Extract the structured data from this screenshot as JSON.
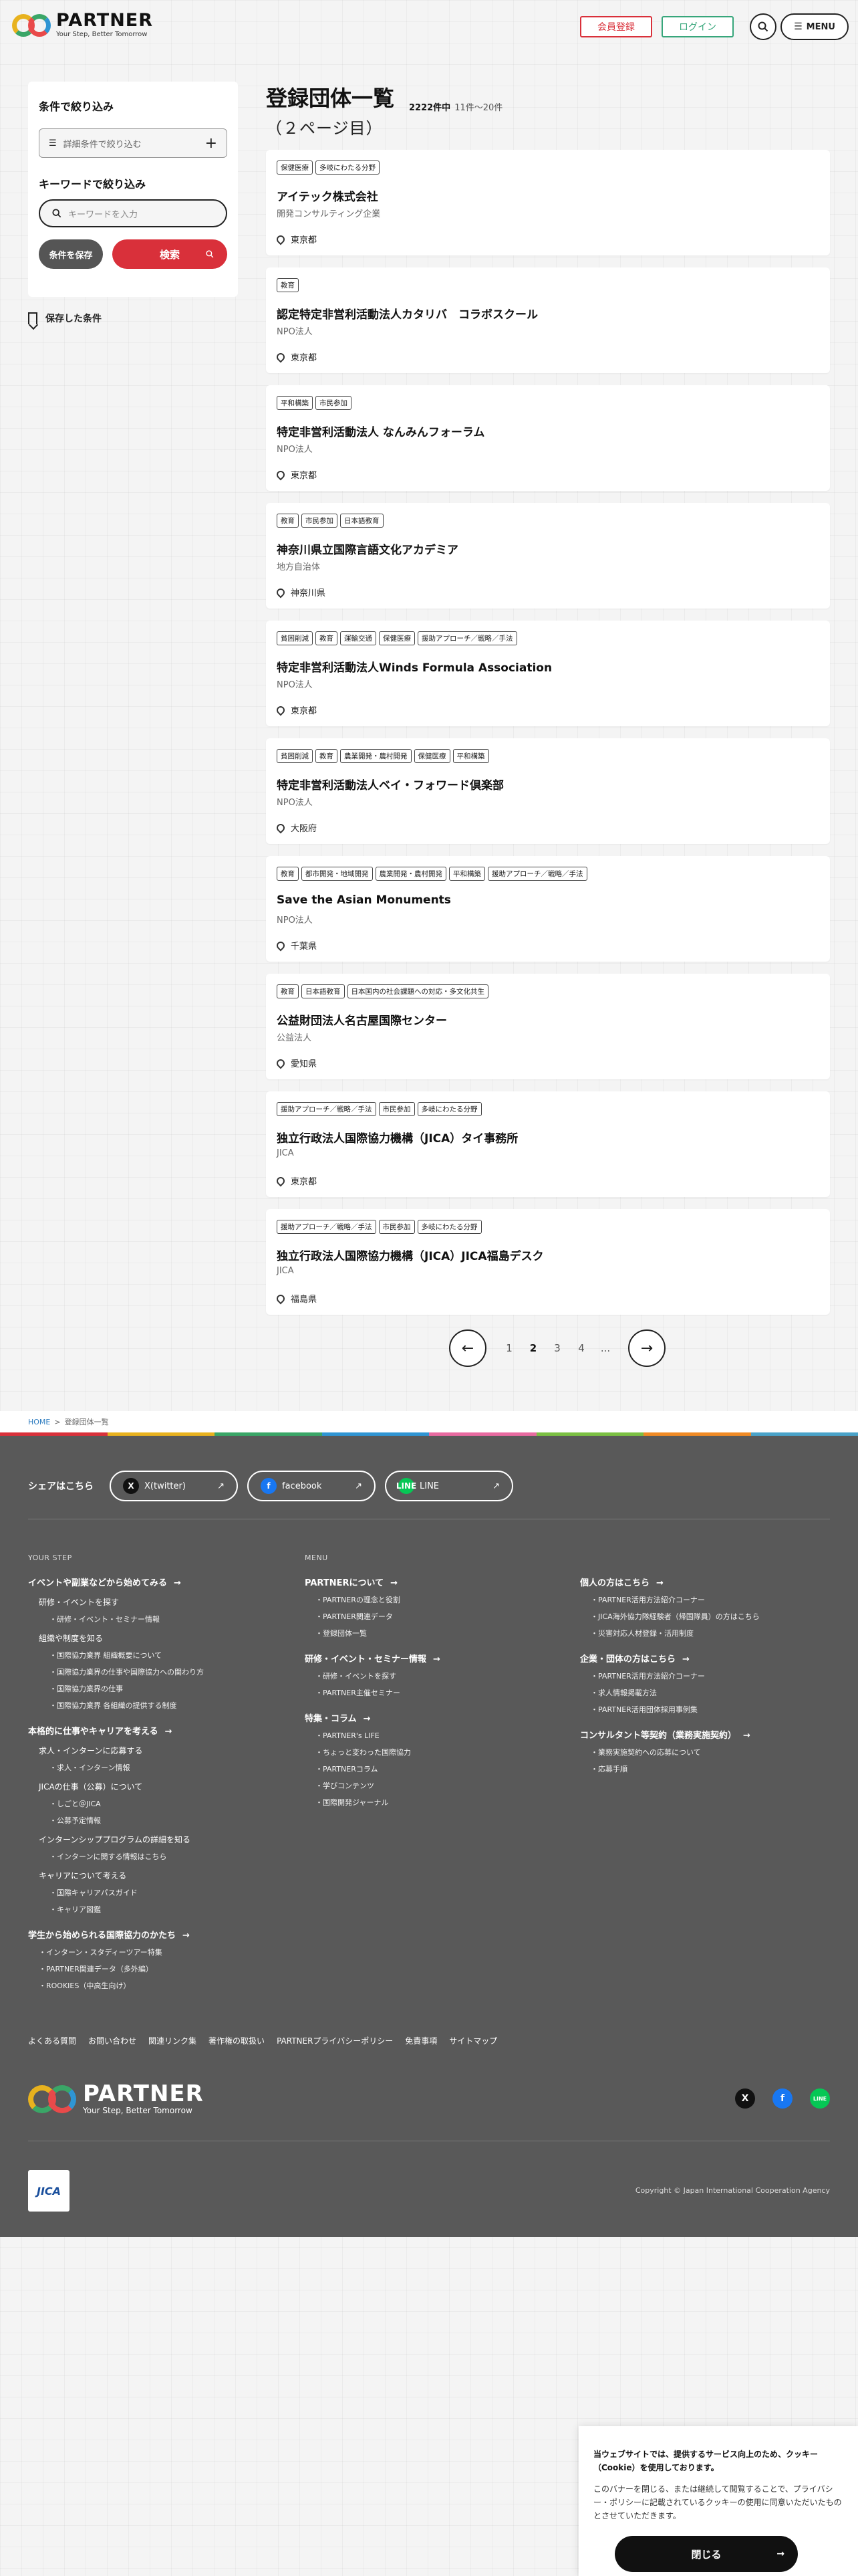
{
  "header": {
    "logo_name": "PARTNER",
    "logo_tagline": "Your Step, Better Tomorrow",
    "register_label": "会員登録",
    "login_label": "ログイン",
    "menu_label": "MENU"
  },
  "filter": {
    "title": "条件で絞り込み",
    "detail_label": "詳細条件で絞り込む",
    "keyword_title": "キーワードで絞り込み",
    "keyword_placeholder": "キーワードを入力",
    "save_label": "条件を保存",
    "search_label": "検索",
    "saved_label": "保存した条件"
  },
  "list": {
    "title": "登録団体一覧",
    "subtitle": "（２ページ目）",
    "total": "2222件中",
    "range": "11件〜20件",
    "items": [
      {
        "tags": [
          "保健医療",
          "多岐にわたる分野"
        ],
        "name": "アイテック株式会社",
        "type": "開発コンサルティング企業",
        "location": "東京都"
      },
      {
        "tags": [
          "教育"
        ],
        "name": "認定特定非営利活動法人カタリバ　コラボスクール",
        "type": "NPO法人",
        "location": "東京都"
      },
      {
        "tags": [
          "平和構築",
          "市民参加"
        ],
        "name": "特定非営利活動法人 なんみんフォーラム",
        "type": "NPO法人",
        "location": "東京都"
      },
      {
        "tags": [
          "教育",
          "市民参加",
          "日本語教育"
        ],
        "name": "神奈川県立国際言語文化アカデミア",
        "type": "地方自治体",
        "location": "神奈川県"
      },
      {
        "tags": [
          "貧困削減",
          "教育",
          "運輸交通",
          "保健医療",
          "援助アプローチ／戦略／手法"
        ],
        "name": "特定非営利活動法人Winds Formula Association",
        "type": "NPO法人",
        "location": "東京都"
      },
      {
        "tags": [
          "貧困削減",
          "教育",
          "農業開発・農村開発",
          "保健医療",
          "平和構築"
        ],
        "name": "特定非営利活動法人ベイ・フォワード倶楽部",
        "type": "NPO法人",
        "location": "大阪府"
      },
      {
        "tags": [
          "教育",
          "都市開発・地域開発",
          "農業開発・農村開発",
          "平和構築",
          "援助アプローチ／戦略／手法"
        ],
        "name": "Save the Asian Monuments",
        "type": "NPO法人",
        "location": "千葉県"
      },
      {
        "tags": [
          "教育",
          "日本語教育",
          "日本国内の社会課題への対応・多文化共生"
        ],
        "name": "公益財団法人名古屋国際センター",
        "type": "公益法人",
        "location": "愛知県"
      },
      {
        "tags": [
          "援助アプローチ／戦略／手法",
          "市民参加",
          "多岐にわたる分野"
        ],
        "name": "独立行政法人国際協力機構（JICA）タイ事務所",
        "type": "JICA",
        "location": "東京都"
      },
      {
        "tags": [
          "援助アプローチ／戦略／手法",
          "市民参加",
          "多岐にわたる分野"
        ],
        "name": "独立行政法人国際協力機構（JICA）JICA福島デスク",
        "type": "JICA",
        "location": "福島県"
      }
    ]
  },
  "pager": {
    "pages": [
      "1",
      "2",
      "3",
      "4"
    ],
    "current": "2",
    "ellipsis": "..."
  },
  "breadcrumb": {
    "home": "HOME",
    "sep": ">",
    "current": "登録団体一覧"
  },
  "stripe_colors": [
    "#d9303a",
    "#e8b21e",
    "#3aa667",
    "#2f95d3",
    "#e86aa0",
    "#7bc043",
    "#f08a24",
    "#4aa3c9"
  ],
  "footer": {
    "share_label": "シェアはこちら",
    "share": [
      {
        "label": "X(twitter)",
        "icon": "X"
      },
      {
        "label": "facebook",
        "icon": "f"
      },
      {
        "label": "LINE",
        "icon": "LINE"
      }
    ],
    "col1": {
      "label": "YOUR STEP",
      "h1": "イベントや副業などから始めてみる",
      "s1": "研修・イベントを探す",
      "s1_items": [
        "研修・イベント・セミナー情報"
      ],
      "s2": "組織や制度を知る",
      "s2_items": [
        "国際協力業界 組織概要について",
        "国際協力業界の仕事や国際協力への関わり方",
        "国際協力業界の仕事",
        "国際協力業界 各組織の提供する制度"
      ],
      "h2": "本格的に仕事やキャリアを考える",
      "s3": "求人・インターンに応募する",
      "s3_items": [
        "求人・インターン情報"
      ],
      "s4": "JICAの仕事（公募）について",
      "s4_items": [
        "しごと＠JICA",
        "公募予定情報"
      ],
      "s5": "インターンシッププログラムの詳細を知る",
      "s5_items": [
        "インターンに関する情報はこちら"
      ],
      "s6": "キャリアについて考える",
      "s6_items": [
        "国際キャリアパスガイド",
        "キャリア図鑑"
      ],
      "h3": "学生から始められる国際協力のかたち",
      "h3_items": [
        "インターン・スタディーツアー特集",
        "PARTNER関連データ（多外編）",
        "ROOKIES（中高生向け）"
      ]
    },
    "col2": {
      "label": "MENU",
      "h1": "PARTNERについて",
      "h1_items": [
        "PARTNERの理念と役割",
        "PARTNER関連データ",
        "登録団体一覧"
      ],
      "h2": "研修・イベント・セミナー情報",
      "h2_items": [
        "研修・イベントを探す",
        "PARTNER主催セミナー"
      ],
      "h3": "特集・コラム",
      "h3_items": [
        "PARTNER's LIFE",
        "ちょっと変わった国際協力",
        "PARTNERコラム",
        "学びコンテンツ",
        "国際開発ジャーナル"
      ]
    },
    "col3": {
      "h1": "個人の方はこちら",
      "h1_items": [
        "PARTNER活用方法紹介コーナー",
        "JICA海外協力隊経験者（帰国隊員）の方はこちら",
        "災害対応人材登録・活用制度"
      ],
      "h2": "企業・団体の方はこちら",
      "h2_items": [
        "PARTNER活用方法紹介コーナー",
        "求人情報掲載方法",
        "PARTNER活用団体採用事例集"
      ],
      "h3": "コンサルタント等契約（業務実施契約）",
      "h3_items": [
        "業務実施契約への応募について",
        "応募手順"
      ]
    },
    "links": [
      "よくある質問",
      "お問い合わせ",
      "関連リンク集",
      "著作権の取扱い",
      "PARTNERプライバシーポリシー",
      "免責事項",
      "サイトマップ"
    ],
    "logo_name": "PARTNER",
    "logo_tagline": "Your Step, Better Tomorrow",
    "jica_label": "JICA",
    "copyright": "Copyright © Japan International Cooperation Agency"
  },
  "cookie": {
    "title": "当ウェブサイトでは、提供するサービス向上のため、クッキー（Cookie）を使用しております。",
    "body": "このバナーを閉じる、または継続して閲覧することで、プライバシー・ポリシーに記載されているクッキーの使用に同意いただいたものとさせていただきます。",
    "close_label": "閉じる"
  }
}
